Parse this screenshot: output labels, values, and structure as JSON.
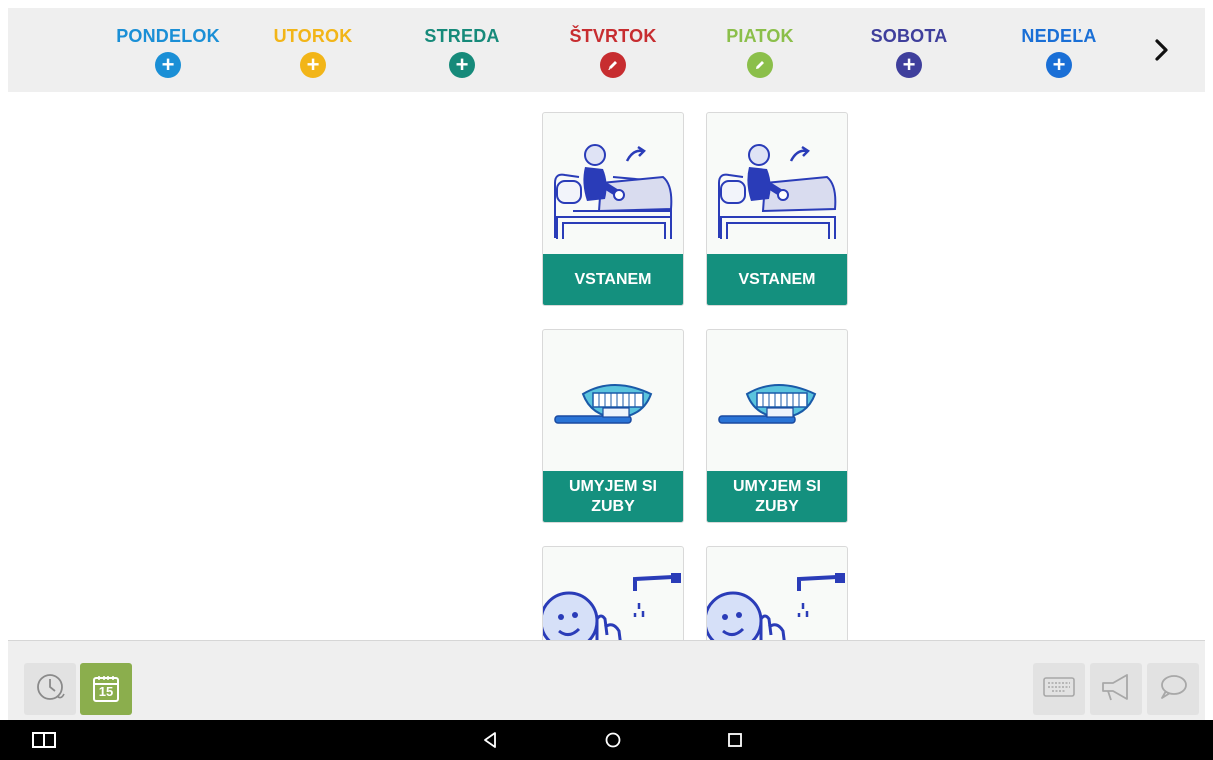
{
  "days": [
    {
      "label": "PONDELOK",
      "color": "#1a8fd6",
      "icon": "plus-icon"
    },
    {
      "label": "UTOROK",
      "color": "#f2b518",
      "icon": "plus-icon"
    },
    {
      "label": "STREDA",
      "color": "#168a7a",
      "icon": "plus-icon"
    },
    {
      "label": "ŠTVRTOK",
      "color": "#c72d30",
      "icon": "pencil-icon"
    },
    {
      "label": "PIATOK",
      "color": "#8bbf4a",
      "icon": "pencil-icon"
    },
    {
      "label": "SOBOTA",
      "color": "#3f3f9c",
      "icon": "plus-icon"
    },
    {
      "label": "NEDEĽA",
      "color": "#1a6fd6",
      "icon": "plus-icon"
    }
  ],
  "next_icon": "chevron-right-icon",
  "cards": [
    {
      "label": "VSTANEM",
      "picture": "getting-up-icon"
    },
    {
      "label": "VSTANEM",
      "picture": "getting-up-icon"
    },
    {
      "label": "UMYJEM SI ZUBY",
      "picture": "brushing-teeth-icon"
    },
    {
      "label": "UMYJEM SI ZUBY",
      "picture": "brushing-teeth-icon"
    },
    {
      "label": "",
      "picture": "washing-face-icon"
    },
    {
      "label": "",
      "picture": "washing-face-icon"
    }
  ],
  "toolbar": {
    "left": [
      "clock-history-icon",
      "calendar-icon"
    ],
    "calendar_day": "15",
    "right": [
      "keyboard-icon",
      "megaphone-icon",
      "speech-bubble-icon"
    ],
    "active_color": "#8bae4d"
  },
  "navbar": [
    "recent-apps-icon",
    "back-icon",
    "home-icon",
    "overview-icon"
  ]
}
